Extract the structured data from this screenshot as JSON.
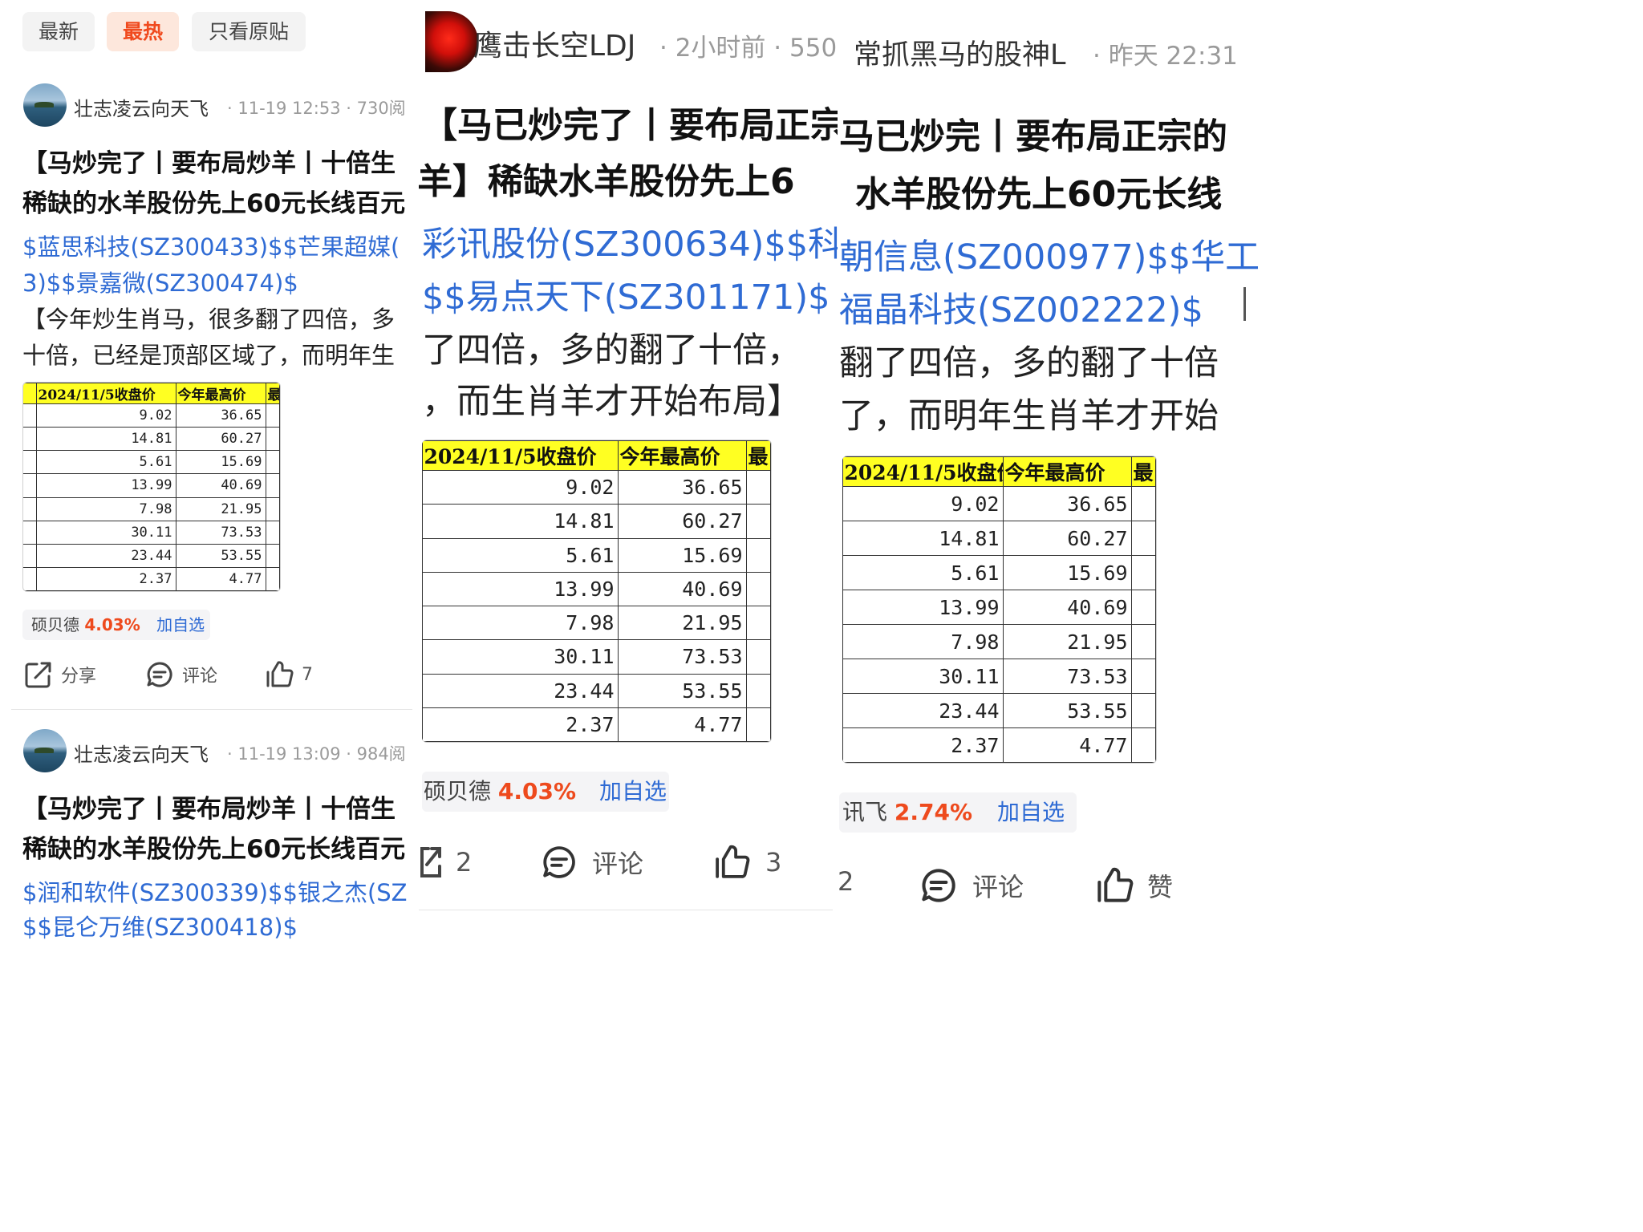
{
  "panel1": {
    "tabs": [
      "最新",
      "最热",
      "只看原贴"
    ],
    "post1": {
      "author": "壮志凌云向天飞",
      "meta": "· 11-19 12:53 · 730阅",
      "title_line1": "【马炒完了丨要布局炒羊丨十倍生",
      "title_line2": "稀缺的水羊股份先上60元长线百元",
      "links_line1": "$蓝思科技(SZ300433)$$芒果超媒(",
      "links_line2": "3)$$景嘉微(SZ300474)$",
      "text_line1": "【今年炒生肖马，很多翻了四倍，多",
      "text_line2": "十倍，已经是顶部区域了，而明年生",
      "stock_name": "硕贝德",
      "stock_pct": "4.03%",
      "stock_add": "加自选",
      "share": "分享",
      "comment": "评论",
      "like_count": "7"
    },
    "post2": {
      "author": "壮志凌云向天飞",
      "meta": "· 11-19 13:09 · 984阅",
      "title_line1": "【马炒完了丨要布局炒羊丨十倍生",
      "title_line2": "稀缺的水羊股份先上60元长线百元",
      "links_line1": "$润和软件(SZ300339)$$银之杰(SZ",
      "links_line2": "$$昆仑万维(SZ300418)$"
    }
  },
  "panel2": {
    "author": "鹰击长空LDJ",
    "meta": "· 2小时前 · 550",
    "title_line1": "【马已炒完了丨要布局正宗",
    "title_line2": "羊】稀缺水羊股份先上6",
    "links_line1": "彩讯股份(SZ300634)$$科",
    "links_line2": "$$易点天下(SZ301171)$",
    "text_line1": "了四倍，多的翻了十倍，",
    "text_line2": "，而生肖羊才开始布局】",
    "stock_name": "硕贝德",
    "stock_pct": "4.03%",
    "stock_add": "加自选",
    "share_count": "2",
    "comment": "评论",
    "like_count": "3"
  },
  "panel3": {
    "author": "常抓黑马的股神L",
    "meta": "· 昨天 22:31",
    "title_line1": "马已炒完丨要布局正宗的",
    "title_line2": "水羊股份先上60元长线",
    "links_line1": "朝信息(SZ000977)$$华工",
    "links_line2": "福晶科技(SZ002222)$",
    "text_line1": "翻了四倍，多的翻了十倍",
    "text_line2": "了，而明年生肖羊才开始",
    "stock_name": "讯飞",
    "stock_pct": "2.74%",
    "stock_add": "加自选",
    "share_count": "2",
    "comment": "评论",
    "like": "赞"
  },
  "table": {
    "headers": [
      "2024/11/5收盘价",
      "今年最高价",
      "最"
    ],
    "rows": [
      [
        "9.02",
        "36.65"
      ],
      [
        "14.81",
        "60.27"
      ],
      [
        "5.61",
        "15.69"
      ],
      [
        "13.99",
        "40.69"
      ],
      [
        "7.98",
        "21.95"
      ],
      [
        "30.11",
        "73.53"
      ],
      [
        "23.44",
        "53.55"
      ],
      [
        "2.37",
        "4.77"
      ]
    ]
  },
  "colors": {
    "link": "#2f6bd4",
    "stock_up": "#ee4a1d",
    "header_yellow": "#ffff22",
    "tab_active_text": "#f04a1e"
  },
  "icons": [
    "share-icon",
    "comment-icon",
    "thumbs-up-icon"
  ]
}
